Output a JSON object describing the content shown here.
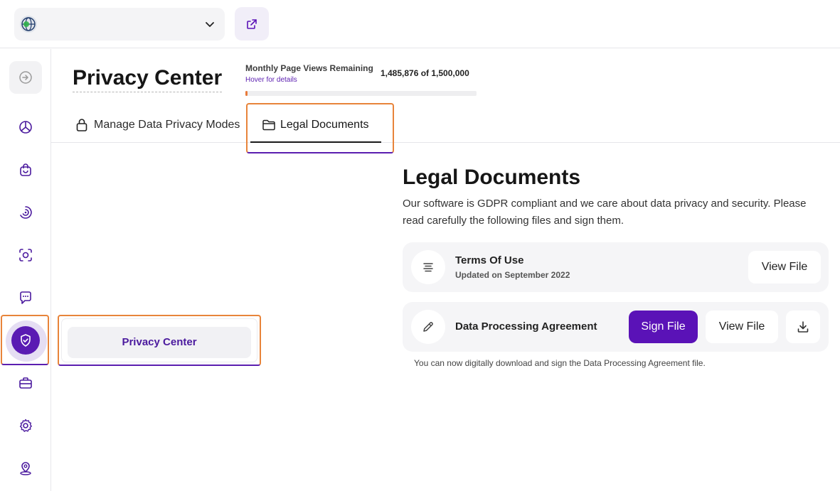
{
  "topbar": {
    "site_icon": "globe-icon",
    "dropdown_icon": "chevron-down-icon",
    "external_icon": "external-link-icon"
  },
  "sidebar": {
    "items": [
      {
        "name": "collapse",
        "icon": "sidebar-collapse-icon"
      },
      {
        "name": "dashboard",
        "icon": "pie-chart-icon"
      },
      {
        "name": "shop",
        "icon": "shopping-bag-icon"
      },
      {
        "name": "analytics",
        "icon": "target-spiral-icon"
      },
      {
        "name": "scan",
        "icon": "eye-scan-icon"
      },
      {
        "name": "messages",
        "icon": "chat-bubble-icon"
      },
      {
        "name": "privacy",
        "icon": "shield-check-icon",
        "active": true
      },
      {
        "name": "briefcase",
        "icon": "briefcase-icon"
      },
      {
        "name": "settings",
        "icon": "gear-icon"
      },
      {
        "name": "location",
        "icon": "map-pin-icon"
      }
    ],
    "flyout_label": "Privacy Center"
  },
  "header": {
    "title": "Privacy Center",
    "usage_label": "Monthly Page Views Remaining",
    "usage_hover": "Hover for details",
    "usage_count": "1,485,876 of 1,500,000",
    "usage_fraction": 0.0101
  },
  "tabs": [
    {
      "label": "Manage Data Privacy Modes",
      "icon": "lock-icon",
      "active": false
    },
    {
      "label": "Legal Documents",
      "icon": "folder-icon",
      "active": true
    }
  ],
  "content": {
    "title": "Legal Documents",
    "description": "Our software is GDPR compliant and we care about data privacy and security. Please read carefully the following files and sign them.",
    "documents": [
      {
        "title": "Terms Of Use",
        "subtitle": "Updated on September 2022",
        "icon": "text-align-icon",
        "view_label": "View File"
      },
      {
        "title": "Data Processing Agreement",
        "icon": "pencil-icon",
        "sign_label": "Sign File",
        "view_label": "View File",
        "download_icon": "download-icon"
      }
    ],
    "note": "You can now digitally download and sign the Data Processing Agreement file."
  },
  "colors": {
    "accent": "#5a12b7",
    "highlight_frame": "#e8843a",
    "progress": "#e87a3a"
  }
}
